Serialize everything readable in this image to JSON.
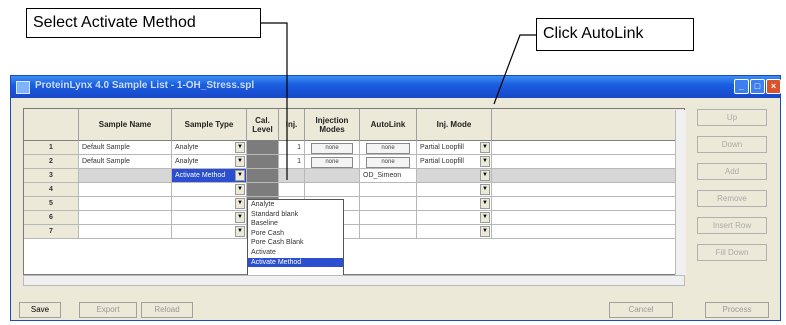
{
  "callouts": {
    "activate": "Select Activate Method",
    "autolink": "Click AutoLink"
  },
  "window": {
    "title": "ProteinLynx 4.0  Sample List - 1-OH_Stress.spl",
    "controls": {
      "minimize": "_",
      "maximize": "□",
      "close": "×"
    }
  },
  "columns": [
    "",
    "Sample Name",
    "Sample Type",
    "Cal. Level",
    "Inj.",
    "Injection Modes",
    "AutoLink",
    "Inj. Mode"
  ],
  "rows": [
    {
      "num": "1",
      "name": "Default Sample",
      "type": "Analyte",
      "inj": "1",
      "injection": "none",
      "autolink": "none",
      "mode": "Partial Loopfill"
    },
    {
      "num": "2",
      "name": "Default Sample",
      "type": "Analyte",
      "inj": "1",
      "injection": "none",
      "autolink": "none",
      "mode": "Partial Loopfill"
    },
    {
      "num": "3",
      "name": "",
      "type": "Activate Method",
      "inj": "",
      "injection": "",
      "autolink": "OD_Simeon",
      "mode": ""
    },
    {
      "num": "4",
      "name": "",
      "type": "",
      "inj": "",
      "injection": "",
      "autolink": "",
      "mode": ""
    },
    {
      "num": "5",
      "name": "",
      "type": "",
      "inj": "",
      "injection": "",
      "autolink": "",
      "mode": ""
    },
    {
      "num": "6",
      "name": "",
      "type": "",
      "inj": "",
      "injection": "",
      "autolink": "",
      "mode": ""
    },
    {
      "num": "7",
      "name": "",
      "type": "",
      "inj": "",
      "injection": "",
      "autolink": "",
      "mode": ""
    }
  ],
  "dropdown_options": [
    "Analyte",
    "Standard blank",
    "Baseline",
    "Pore Cash",
    "Pore Cash Blank",
    "Activate",
    "Activate Method"
  ],
  "side_buttons": [
    "Up",
    "Down",
    "Add",
    "Remove",
    "Insert Row",
    "Fill Down"
  ],
  "bottom_buttons": [
    "Save",
    "Export",
    "Reload",
    "Cancel",
    "Process"
  ]
}
